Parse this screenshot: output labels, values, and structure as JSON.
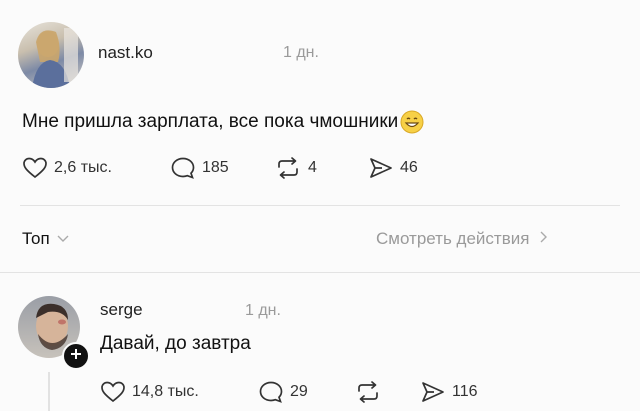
{
  "post": {
    "username": "nast.ko",
    "time": "1 дн.",
    "text": "Мне пришла зарплата, все пока чмошники",
    "emoji": "😁",
    "likes": "2,6 тыс.",
    "comments": "185",
    "reposts": "4",
    "shares": "46"
  },
  "filter": {
    "sort_label": "Топ",
    "view_activity_label": "Смотреть действия"
  },
  "reply": {
    "username": "serge",
    "time": "1 дн.",
    "text": "Давай, до завтра",
    "likes": "14,8 тыс.",
    "comments": "29",
    "shares": "116"
  },
  "icons": {
    "like": "heart-icon",
    "comment": "comment-icon",
    "repost": "repost-icon",
    "share": "send-icon",
    "follow": "plus-icon",
    "sort_dropdown": "chevron-down-icon",
    "view_activity": "chevron-right-icon"
  },
  "colors": {
    "background": "#fbfbfb",
    "text": "#111111",
    "muted": "#9a9a9a",
    "divider": "#e3e3e3",
    "follow_badge": "#111111"
  }
}
